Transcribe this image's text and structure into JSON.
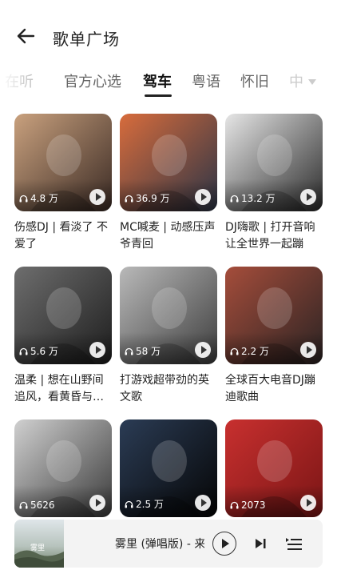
{
  "header": {
    "title": "歌单广场",
    "back_icon": "back-arrow-icon"
  },
  "tabs": [
    {
      "label": "在听",
      "state": "partial"
    },
    {
      "label": "官方心选",
      "state": "normal"
    },
    {
      "label": "驾车",
      "state": "active"
    },
    {
      "label": "粤语",
      "state": "normal"
    },
    {
      "label": "怀旧",
      "state": "normal"
    },
    {
      "label": "中",
      "state": "partial"
    }
  ],
  "playlists": [
    {
      "title": "伤感DJ | 看淡了 不爱了",
      "plays": "4.8 万",
      "palette": [
        "#c9a17e",
        "#3a2a24"
      ]
    },
    {
      "title": "MC喊麦 | 动感压声爷青回",
      "plays": "36.9 万",
      "palette": [
        "#d86c3c",
        "#2b3446"
      ]
    },
    {
      "title": "DJ嗨歌 | 打开音响让全世界一起蹦",
      "plays": "13.2 万",
      "palette": [
        "#e6e6e6",
        "#2a2a2a"
      ]
    },
    {
      "title": "温柔 | 想在山野间追风，看黄昏与晚霞",
      "plays": "5.6 万",
      "palette": [
        "#6e6e6e",
        "#1d1d1d"
      ]
    },
    {
      "title": "打游戏超带劲的英文歌",
      "plays": "58 万",
      "palette": [
        "#b9b9b9",
        "#3d3d3d"
      ]
    },
    {
      "title": "全球百大电音DJ蹦迪歌曲",
      "plays": "2.2 万",
      "palette": [
        "#a54d3b",
        "#2a2323"
      ]
    },
    {
      "title": "",
      "plays": "5626",
      "palette": [
        "#d0d0d0",
        "#3a3a3a"
      ]
    },
    {
      "title": "",
      "plays": "2.5 万",
      "palette": [
        "#2b3c55",
        "#050505"
      ]
    },
    {
      "title": "",
      "plays": "2073",
      "palette": [
        "#c8302f",
        "#7a1515"
      ]
    }
  ],
  "player": {
    "track": "雾里 (弹唱版) - 来",
    "cover_text": "雾里"
  },
  "colors": {
    "accent": "#222222",
    "muted_tab": "#666666",
    "player_bg": "#f3f3f3"
  }
}
